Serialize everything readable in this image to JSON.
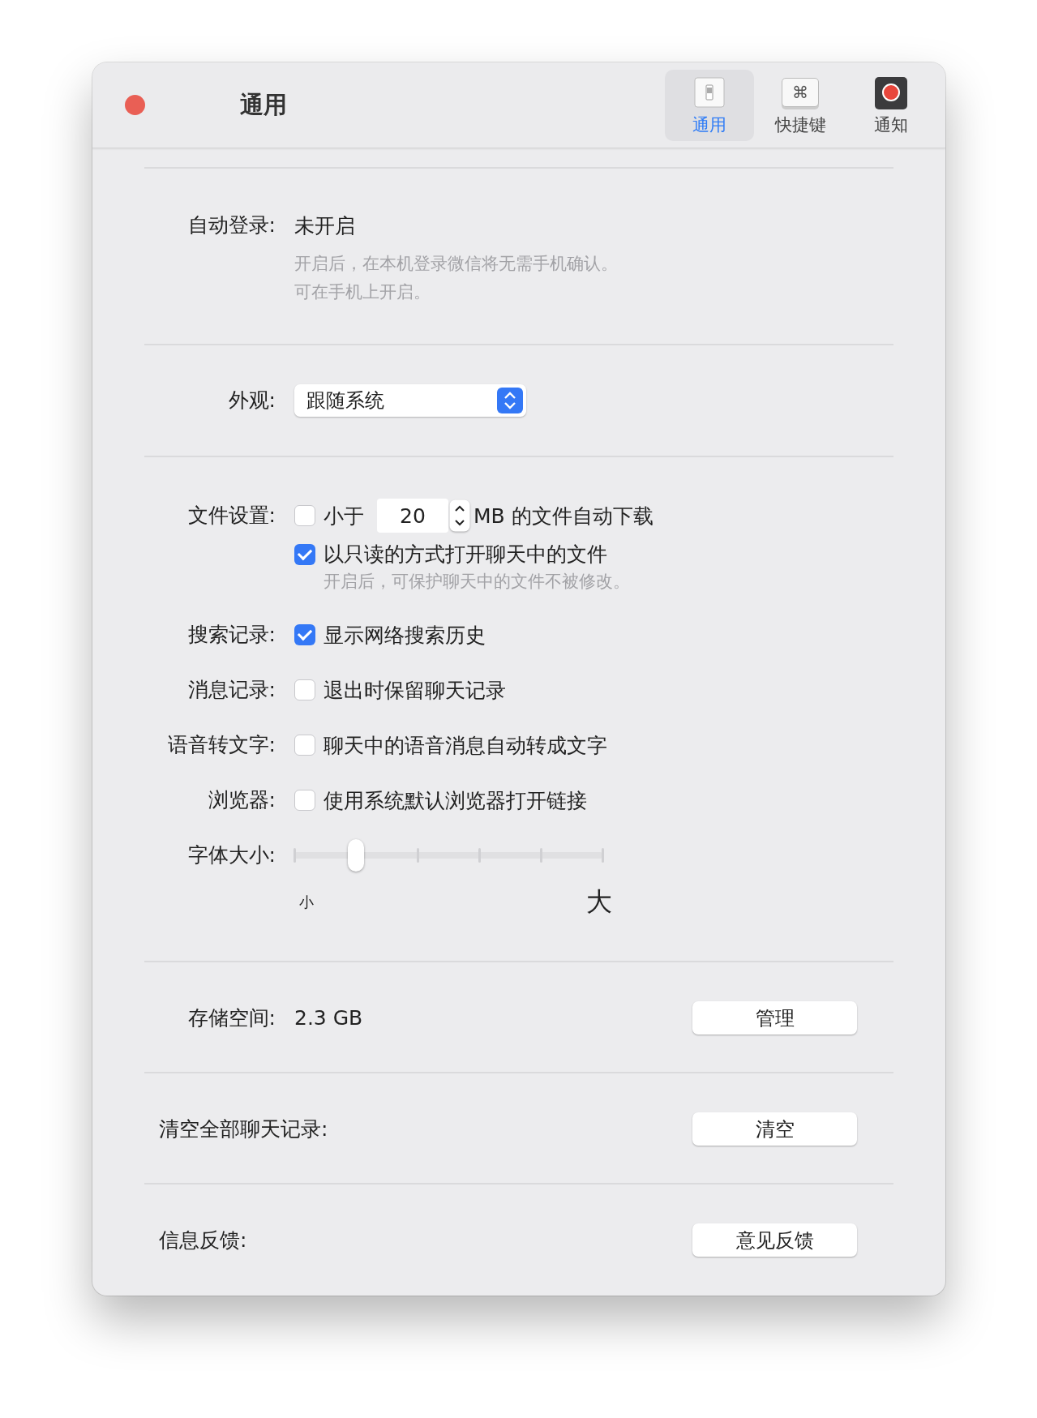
{
  "window": {
    "title": "通用"
  },
  "toolbar": {
    "tabs": [
      {
        "label": "通用",
        "kind": "switch",
        "selected": true
      },
      {
        "label": "快捷键",
        "kind": "key",
        "glyph": "⌘",
        "selected": false
      },
      {
        "label": "通知",
        "kind": "record",
        "selected": false
      }
    ]
  },
  "auto_login": {
    "label": "自动登录:",
    "value": "未开启",
    "hints": [
      "开启后，在本机登录微信将无需手机确认。",
      "可在手机上开启。"
    ]
  },
  "appearance": {
    "label": "外观:",
    "value": "跟随系统"
  },
  "settings": [
    {
      "kind": "size",
      "label": "文件设置:",
      "checked": false,
      "text": "小于",
      "value": "20",
      "unit": "MB 的文件自动下载"
    },
    {
      "kind": "check",
      "checked": true,
      "text": "以只读的方式打开聊天中的文件",
      "hint": "开启后，可保护聊天中的文件不被修改。"
    },
    {
      "kind": "check",
      "label": "搜索记录:",
      "checked": true,
      "text": "显示网络搜索历史"
    },
    {
      "kind": "check",
      "label": "消息记录:",
      "checked": false,
      "text": "退出时保留聊天记录"
    },
    {
      "kind": "check",
      "label": "语音转文字:",
      "checked": false,
      "text": "聊天中的语音消息自动转成文字"
    },
    {
      "kind": "check",
      "label": "浏览器:",
      "checked": false,
      "text": "使用系统默认浏览器打开链接"
    },
    {
      "kind": "slider",
      "label": "字体大小:",
      "level": 0.2,
      "min_label": "小",
      "max_label": "大"
    }
  ],
  "actions": [
    {
      "label": "存储空间:",
      "value": "2.3 GB",
      "button": "管理"
    },
    {
      "label": "清空全部聊天记录:",
      "button": "清空"
    },
    {
      "label": "信息反馈:",
      "button": "意见反馈"
    }
  ]
}
